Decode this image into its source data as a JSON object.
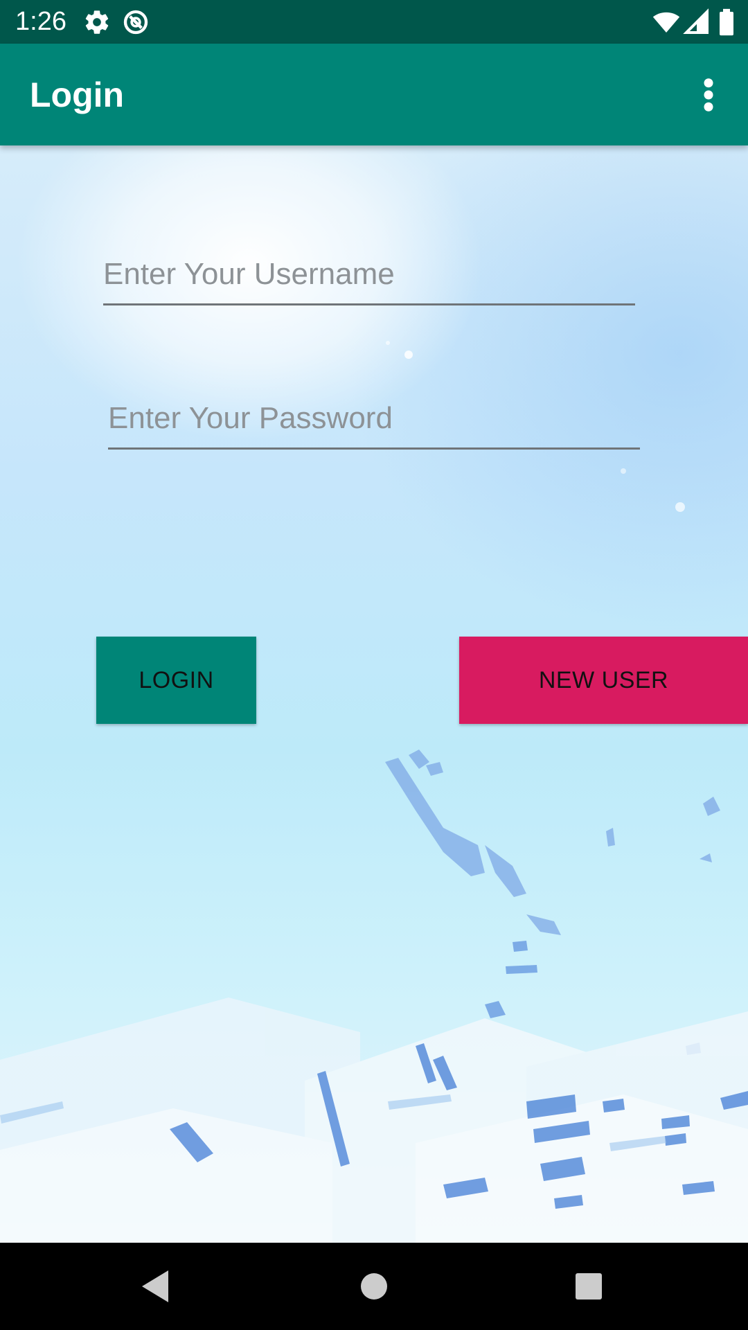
{
  "status_bar": {
    "time": "1:26",
    "icons_left": [
      "settings-icon",
      "data-saver-icon"
    ],
    "icons_right": [
      "wifi-icon",
      "signal-icon",
      "battery-icon"
    ]
  },
  "app_bar": {
    "title": "Login",
    "menu_icon": "more-vert-icon"
  },
  "form": {
    "username_placeholder": "Enter Your Username",
    "username_value": "",
    "password_placeholder": "Enter Your Password",
    "password_value": ""
  },
  "buttons": {
    "login_label": "LOGIN",
    "new_user_label": "NEW USER"
  },
  "nav_bar": {
    "icons": [
      "back-icon",
      "home-icon",
      "recents-icon"
    ]
  },
  "colors": {
    "status_bar": "#00574b",
    "app_bar": "#008577",
    "login_button": "#008577",
    "new_user_button": "#d81b60"
  }
}
